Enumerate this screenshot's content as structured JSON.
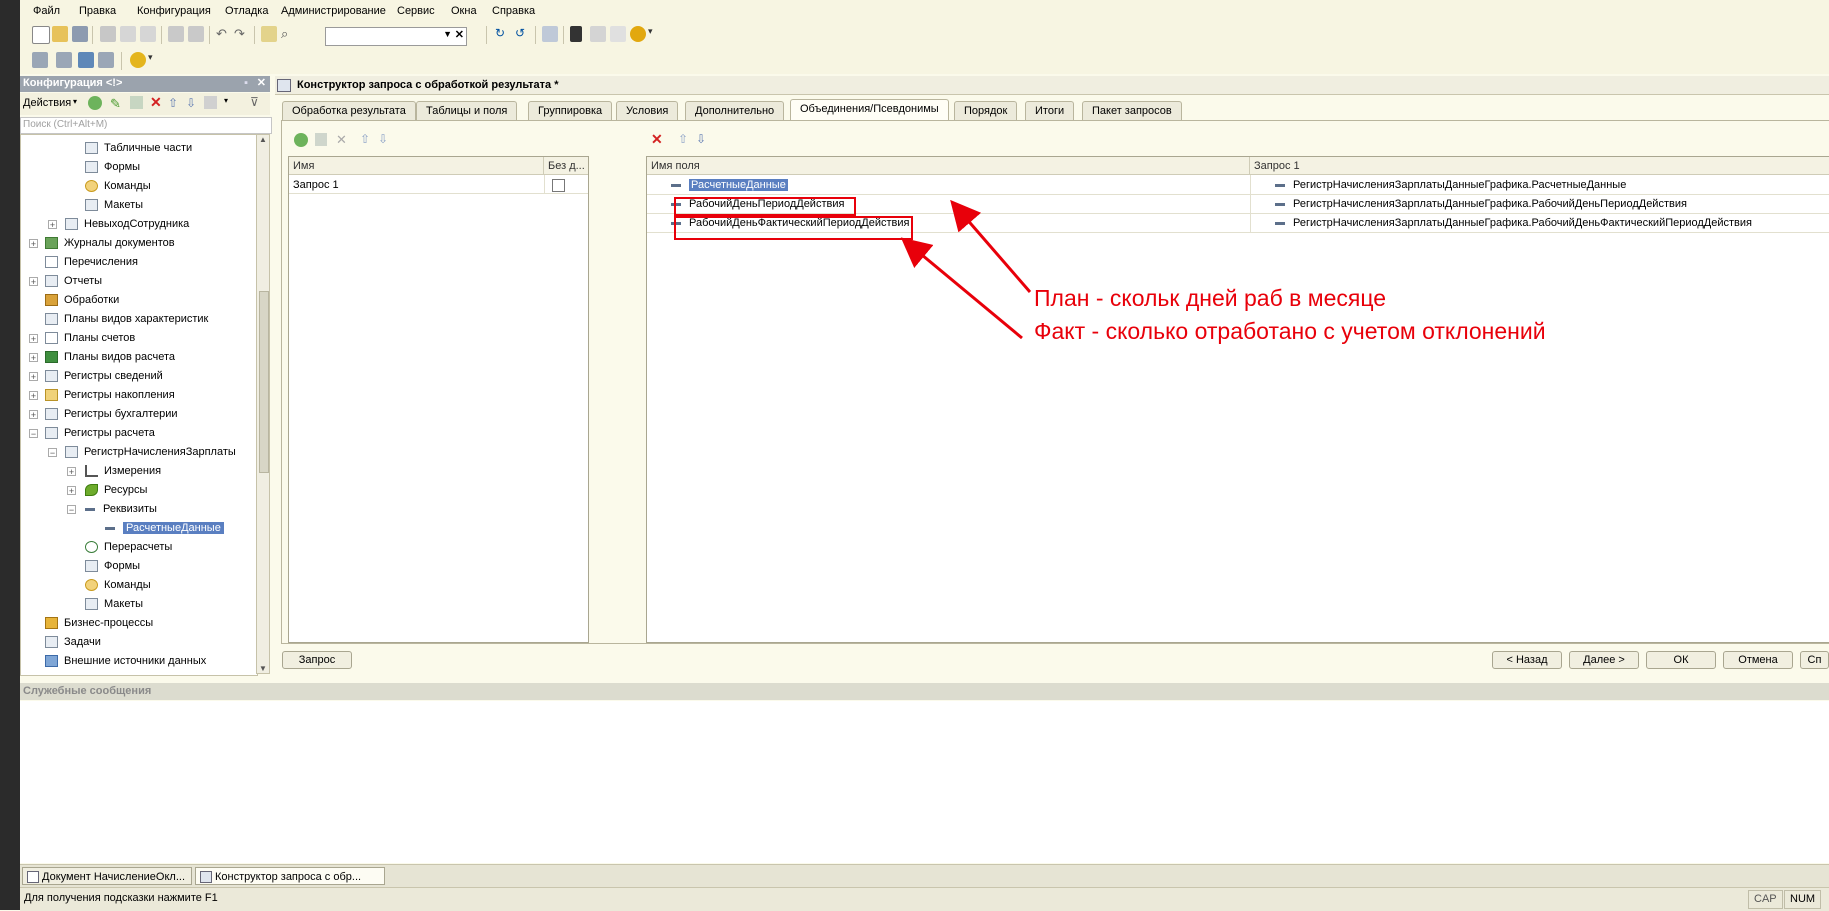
{
  "menu": [
    "Файл",
    "Правка",
    "Конфигурация",
    "Отладка",
    "Администрирование",
    "Сервис",
    "Окна",
    "Справка"
  ],
  "config_panel": {
    "title": "Конфигурация <!>",
    "actions_label": "Действия",
    "search_placeholder": "Поиск (Ctrl+Alt+M)",
    "tree": [
      {
        "label": "Табличные части"
      },
      {
        "label": "Формы"
      },
      {
        "label": "Команды"
      },
      {
        "label": "Макеты"
      },
      {
        "label": "НевыходСотрудника"
      },
      {
        "label": "Журналы документов"
      },
      {
        "label": "Перечисления"
      },
      {
        "label": "Отчеты"
      },
      {
        "label": "Обработки"
      },
      {
        "label": "Планы видов характеристик"
      },
      {
        "label": "Планы счетов"
      },
      {
        "label": "Планы видов расчета"
      },
      {
        "label": "Регистры сведений"
      },
      {
        "label": "Регистры накопления"
      },
      {
        "label": "Регистры бухгалтерии"
      },
      {
        "label": "Регистры расчета"
      },
      {
        "label": "РегистрНачисленияЗарплаты"
      },
      {
        "label": "Измерения"
      },
      {
        "label": "Ресурсы"
      },
      {
        "label": "Реквизиты"
      },
      {
        "label": "РасчетныеДанные"
      },
      {
        "label": "Перерасчеты"
      },
      {
        "label": "Формы"
      },
      {
        "label": "Команды"
      },
      {
        "label": "Макеты"
      },
      {
        "label": "Бизнес-процессы"
      },
      {
        "label": "Задачи"
      },
      {
        "label": "Внешние источники данных"
      }
    ]
  },
  "constructor": {
    "title": "Конструктор запроса с обработкой результата *",
    "tabs": [
      "Обработка результата",
      "Таблицы и поля",
      "Группировка",
      "Условия",
      "Дополнительно",
      "Объединения/Псевдонимы",
      "Порядок",
      "Итоги",
      "Пакет запросов"
    ],
    "active_tab": "Объединения/Псевдонимы",
    "queries_table": {
      "col_name": "Имя",
      "col_distinct": "Без д...",
      "rows": [
        {
          "name": "Запрос 1",
          "distinct": false
        }
      ]
    },
    "fields_table": {
      "col_field": "Имя поля",
      "col_query1": "Запрос 1",
      "rows": [
        {
          "field": "РасчетныеДанные",
          "query1": "РегистрНачисленияЗарплатыДанныеГрафика.РасчетныеДанные"
        },
        {
          "field": "РабочийДеньПериодДействия",
          "query1": "РегистрНачисленияЗарплатыДанныеГрафика.РабочийДеньПериодДействия"
        },
        {
          "field": "РабочийДеньФактическийПериодДействия",
          "query1": "РегистрНачисленияЗарплатыДанныеГрафика.РабочийДеньФактическийПериодДействия"
        }
      ]
    },
    "buttons": {
      "query": "Запрос",
      "back": "< Назад",
      "next": "Далее >",
      "ok": "ОК",
      "cancel": "Отмена",
      "help": "Сп"
    }
  },
  "annotation": {
    "line1": "План - скольк дней раб в месяце",
    "line2": "Факт - сколько отработано с учетом отклонений",
    "color": "#e8000a"
  },
  "messages_title": "Служебные сообщения",
  "taskbar": [
    "Документ НачислениеОкл...",
    "Конструктор запроса с обр..."
  ],
  "status": {
    "hint": "Для получения подсказки нажмите F1",
    "cap": "CAP",
    "num": "NUM"
  }
}
